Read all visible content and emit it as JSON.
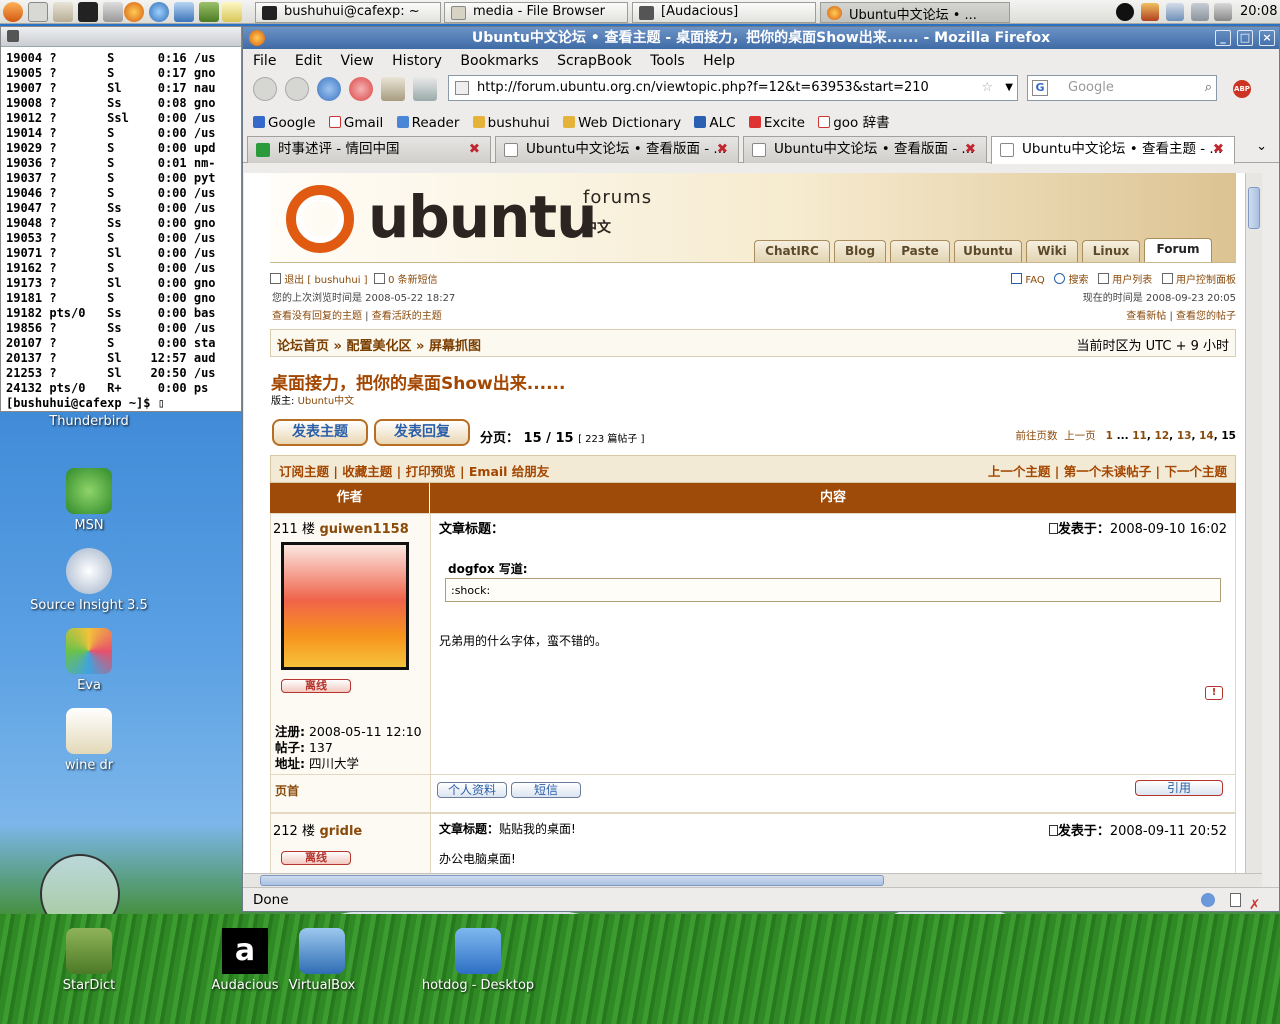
{
  "panel": {
    "tasks": [
      "bushuhui@cafexp: ~",
      "media - File Browser",
      "[Audacious]",
      "Ubuntu中文论坛 • ..."
    ],
    "clock": "20:08"
  },
  "terminal": {
    "lines": [
      "19004 ?       S      0:16 /us",
      "19005 ?       S      0:17 gno",
      "19007 ?       Sl     0:17 nau",
      "19008 ?       Ss     0:08 gno",
      "19012 ?       Ssl    0:00 /us",
      "19014 ?       S      0:00 /us",
      "19029 ?       S      0:00 upd",
      "19036 ?       S      0:01 nm-",
      "19037 ?       S      0:00 pyt",
      "19046 ?       S      0:00 /us",
      "19047 ?       Ss     0:00 /us",
      "19048 ?       Ss     0:00 gno",
      "19053 ?       S      0:00 /us",
      "19071 ?       Sl     0:00 /us",
      "19162 ?       S      0:00 /us",
      "19173 ?       Sl     0:00 gno",
      "19181 ?       S      0:00 gno",
      "19182 pts/0   Ss     0:00 bas",
      "19856 ?       Ss     0:00 /us",
      "20107 ?       S      0:00 sta",
      "20137 ?       Sl    12:57 aud",
      "21253 ?       Sl    20:50 /us",
      "24132 pts/0   R+     0:00 ps ",
      "[bushuhui@cafexp ~]$ "
    ]
  },
  "desktop_icons": [
    "Thunderbird",
    "MSN",
    "Source Insight 3.5",
    "Eva",
    "wine dr",
    "StarDict",
    "Audacious",
    "VirtualBox",
    "hotdog - Desktop"
  ],
  "firefox": {
    "title": "Ubuntu中文论坛 • 查看主题 - 桌面接力，把你的桌面Show出来...... - Mozilla Firefox",
    "menu": [
      "File",
      "Edit",
      "View",
      "History",
      "Bookmarks",
      "ScrapBook",
      "Tools",
      "Help"
    ],
    "url": "http://forum.ubuntu.org.cn/viewtopic.php?f=12&t=63953&start=210",
    "search_placeholder": "Google",
    "bookmarks": [
      "Google",
      "Gmail",
      "Reader",
      "bushuhui",
      "Web Dictionary",
      "ALC",
      "Excite",
      "goo 辞書"
    ],
    "tabs": [
      "时事述评 - 情回中国",
      "Ubuntu中文论坛 • 查看版面 - ...",
      "Ubuntu中文论坛 • 查看版面 - ...",
      "Ubuntu中文论坛 • 查看主题 - ..."
    ],
    "status": "Done"
  },
  "forum": {
    "brand": "ubuntu",
    "forums_word": "forums",
    "cn_word": "中文",
    "nav_tabs": [
      "ChatIRC",
      "Blog",
      "Paste",
      "Ubuntu",
      "Wiki",
      "Linux",
      "Forum"
    ],
    "logout": "退出 [ bushuhui ]",
    "pm": "0 条新短信",
    "last_visit": "您的上次浏览时间是 2008-05-22 18:27",
    "no_reply": "查看没有回复的主题",
    "active": "查看活跃的主题",
    "faq": "FAQ",
    "search": "搜索",
    "memberlist": "用户列表",
    "ucp": "用户控制面板",
    "now": "现在的时间是 2008-09-23 20:05",
    "new_posts": "查看新帖",
    "your_posts": "查看您的帖子",
    "breadcrumb": [
      "论坛首页",
      "配置美化区",
      "屏幕抓图"
    ],
    "timezone": "当前时区为 UTC + 9 小时",
    "topic_title": "桌面接力，把你的桌面Show出来......",
    "moderator_label": "版主:",
    "moderator": "Ubuntu中文",
    "new_topic": "发表主题",
    "reply": "发表回复",
    "page_label": "分页：",
    "page_value": "15 / 15",
    "post_count": "[ 223 篇帖子 ]",
    "goto": "前往页数",
    "prev": "上一页",
    "pages": [
      "1",
      "...",
      "11",
      "12",
      "13",
      "14",
      "15"
    ],
    "actions_left": [
      "订阅主题",
      "收藏主题",
      "打印预览",
      "Email 给朋友"
    ],
    "actions_right": [
      "上一个主题",
      "第一个未读帖子",
      "下一个主题"
    ],
    "col_author": "作者",
    "col_content": "内容",
    "post1": {
      "floor": "211 楼",
      "author": "guiwen1158",
      "subject_label": "文章标题：",
      "posted_label": "发表于：",
      "posted": "2008-09-10 16:02",
      "quote_author": "dogfox 写道:",
      "quote": ":shock:",
      "body": "兄弟用的什么字体，蛮不错的。",
      "status": "离线",
      "reg_label": "注册:",
      "reg": "2008-05-11 12:10",
      "posts_label": "帖子:",
      "posts": "137",
      "loc_label": "地址:",
      "loc": "四川大学",
      "top": "页首",
      "profile": "个人资料",
      "pmbtn": "短信",
      "quotebtn": "引用"
    },
    "post2": {
      "floor": "212 楼",
      "author": "gridle",
      "subject_label": "文章标题：",
      "subject": "贴贴我的桌面!",
      "posted_label": "发表于：",
      "posted": "2008-09-11 20:52",
      "status": "离线",
      "body": "办公电脑桌面!"
    }
  },
  "colors": {
    "accent": "#9e4a08",
    "link": "#8a4a0a",
    "brand_orange": "#e05a12"
  }
}
